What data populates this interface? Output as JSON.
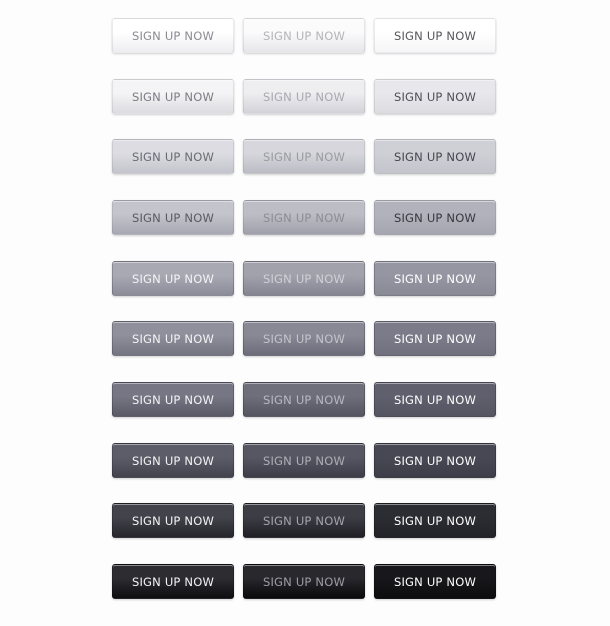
{
  "label": "SIGN UP NOW",
  "rows": [
    {
      "c1": [
        "#ffffff",
        "#eeeef1"
      ],
      "c2": [
        "#fbfbfc",
        "#e6e6ea"
      ],
      "c3": [
        "#ffffff",
        "#f6f6f8"
      ],
      "t1": "#8a8a92",
      "t2": "#b4b4ba",
      "t3": "#55555c"
    },
    {
      "c1": [
        "#f4f4f6",
        "#dcdce1"
      ],
      "c2": [
        "#eeeef1",
        "#d2d2d8"
      ],
      "c3": [
        "#e8e8ec",
        "#dcdce1"
      ],
      "t1": "#7b7b84",
      "t2": "#a8a8b0",
      "t3": "#4e4e56"
    },
    {
      "c1": [
        "#dcdce2",
        "#c4c4cc"
      ],
      "c2": [
        "#d6d6dc",
        "#bcbcc5"
      ],
      "c3": [
        "#cfcfd6",
        "#c4c4cc"
      ],
      "t1": "#6a6a73",
      "t2": "#9a9aa3",
      "t3": "#45454d"
    },
    {
      "c1": [
        "#c4c4cc",
        "#a8a8b3"
      ],
      "c2": [
        "#bdbdc6",
        "#a0a0ab"
      ],
      "c3": [
        "#b2b2bc",
        "#a6a6b0"
      ],
      "t1": "#5a5a63",
      "t2": "#8c8c96",
      "t3": "#36363d"
    },
    {
      "c1": [
        "#a9a9b4",
        "#8c8c99"
      ],
      "c2": [
        "#a2a2ad",
        "#858592"
      ],
      "c3": [
        "#9696a2",
        "#8a8a97"
      ],
      "t1": "#f4f4f6",
      "t2": "#d0d0d6",
      "t3": "#ffffff"
    },
    {
      "c1": [
        "#90909c",
        "#747482"
      ],
      "c2": [
        "#898996",
        "#6c6c7a"
      ],
      "c3": [
        "#7b7b89",
        "#70707e"
      ],
      "t1": "#f4f4f6",
      "t2": "#c4c4cb",
      "t3": "#ffffff"
    },
    {
      "c1": [
        "#767684",
        "#5a5a67"
      ],
      "c2": [
        "#6f6f7c",
        "#545461"
      ],
      "c3": [
        "#5f5f6d",
        "#555562"
      ],
      "t1": "#f4f4f6",
      "t2": "#b8b8c0",
      "t3": "#ffffff"
    },
    {
      "c1": [
        "#5d5d69",
        "#43434e"
      ],
      "c2": [
        "#575763",
        "#3d3d48"
      ],
      "c3": [
        "#484854",
        "#3e3e49"
      ],
      "t1": "#f4f4f6",
      "t2": "#aeaeb6",
      "t3": "#ffffff"
    },
    {
      "c1": [
        "#43434b",
        "#25252b"
      ],
      "c2": [
        "#3d3d45",
        "#1f1f25"
      ],
      "c3": [
        "#2c2c33",
        "#222228"
      ],
      "t1": "#f4f4f6",
      "t2": "#a4a4ac",
      "t3": "#ffffff"
    },
    {
      "c1": [
        "#2c2c31",
        "#0e0e11"
      ],
      "c2": [
        "#28282d",
        "#0a0a0c"
      ],
      "c3": [
        "#18181c",
        "#0c0c0e"
      ],
      "t1": "#f4f4f6",
      "t2": "#9c9ca4",
      "t3": "#ffffff"
    }
  ]
}
